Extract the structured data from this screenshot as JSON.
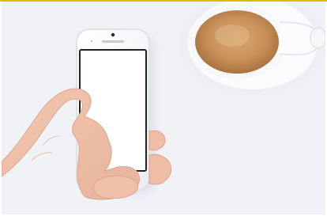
{
  "image": {
    "subject": "hand-holding-smartphone-with-coffee-cup",
    "colors": {
      "accent": "#f0b400",
      "background": "#f1f2f6",
      "skin": "#efbfa8",
      "phone_body": "#f7f7f9",
      "screen": "#ffffff",
      "coffee": "#cf9a62",
      "cup": "#fafafa"
    }
  }
}
